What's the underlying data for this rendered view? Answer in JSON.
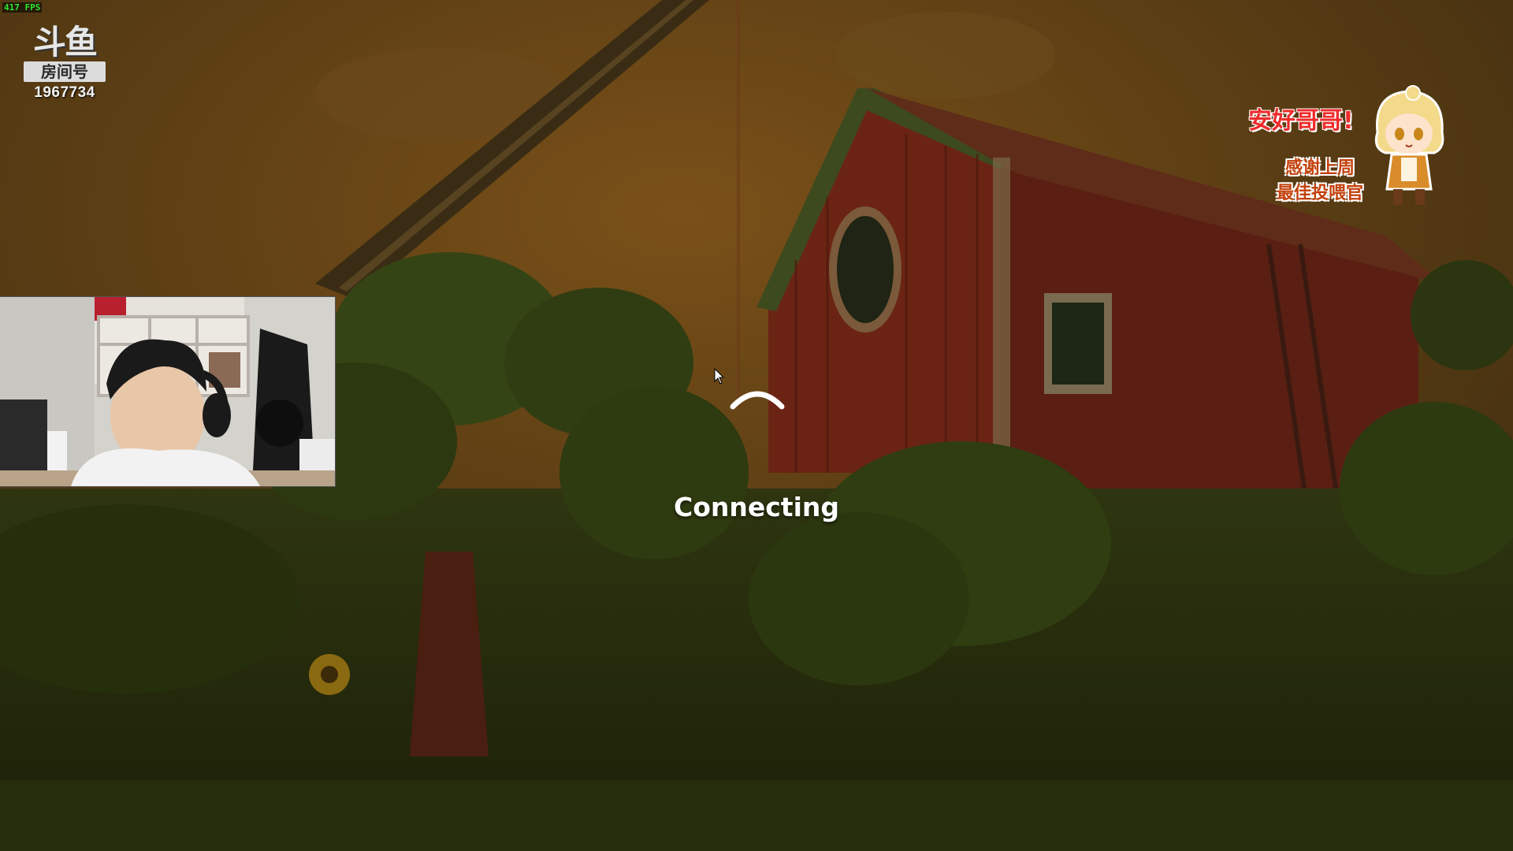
{
  "overlay": {
    "fps_text": "417 FPS",
    "platform_logo_icon": "douyu-logo-icon",
    "platform_logo_text": "斗鱼",
    "room_label": "房间号",
    "room_number": "1967734"
  },
  "game": {
    "status_text": "Connecting",
    "spinner_icon": "loading-spinner-icon",
    "cursor_icon": "mouse-cursor-icon"
  },
  "stream_decor": {
    "greeting": "安好哥哥!",
    "thanks_line1": "感谢上周",
    "thanks_line2": "最佳投喂官",
    "mascot_icon": "anime-mascot-sticker"
  },
  "webcam": {
    "icon": "webcam-feed"
  },
  "colors": {
    "fps_green": "#2ee62e",
    "greeting_red": "#ee2b2b",
    "thanks_orange": "#c2410c",
    "scene_sky": "#6e4a16",
    "scene_foliage": "#2e3a12",
    "barn_red": "#6b2414"
  }
}
